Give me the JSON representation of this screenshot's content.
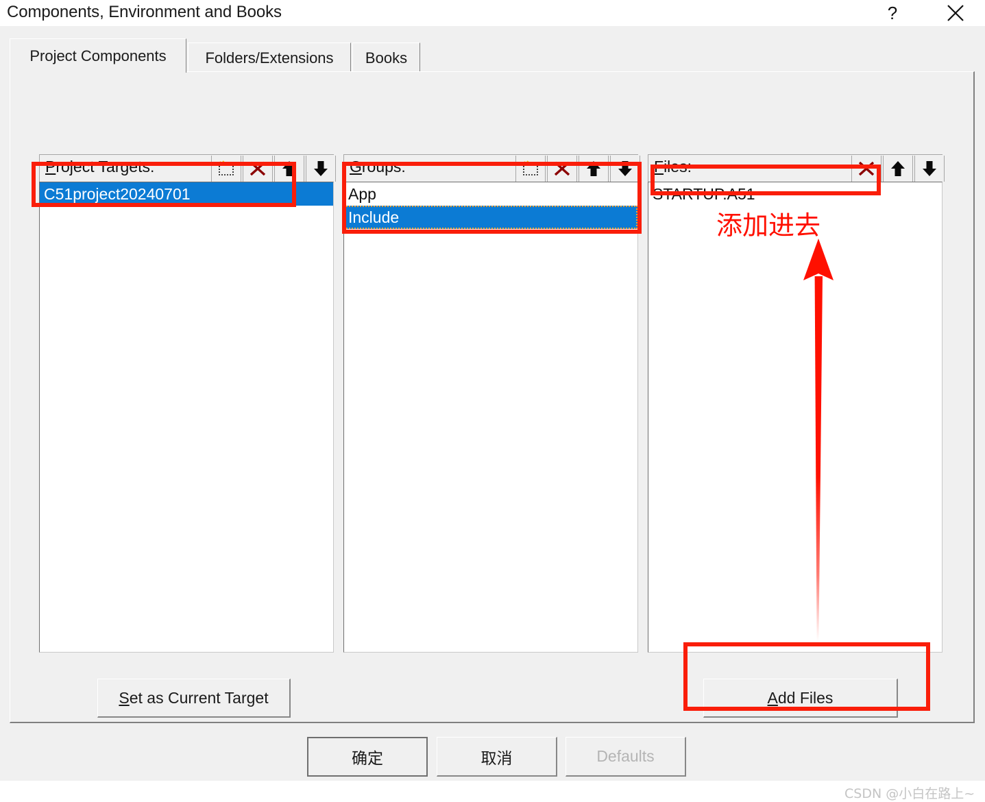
{
  "window": {
    "title": "Components, Environment and Books",
    "help_label": "?",
    "close_label": "close-icon"
  },
  "tabs": [
    {
      "label": "Project Components",
      "selected": true
    },
    {
      "label": "Folders/Extensions",
      "selected": false
    },
    {
      "label": "Books",
      "selected": false
    }
  ],
  "columns": {
    "project_targets": {
      "label_accel": "P",
      "label_rest": "roject Targets:",
      "toolbar": [
        "new-item-icon",
        "delete-icon",
        "move-up-icon",
        "move-down-icon"
      ],
      "items": [
        {
          "text": "C51project20240701",
          "selected": true,
          "focused": false
        }
      ]
    },
    "groups": {
      "label_accel": "G",
      "label_rest": "roups:",
      "toolbar": [
        "new-item-icon",
        "delete-icon",
        "move-up-icon",
        "move-down-icon"
      ],
      "items": [
        {
          "text": "App",
          "selected": false,
          "focused": false
        },
        {
          "text": "Include",
          "selected": true,
          "focused": true
        }
      ]
    },
    "files": {
      "label_accel": "F",
      "label_rest": "iles:",
      "toolbar": [
        "delete-icon",
        "move-up-icon",
        "move-down-icon"
      ],
      "items": [
        {
          "text": "STARTUP.A51",
          "selected": false,
          "focused": false
        }
      ]
    }
  },
  "buttons": {
    "set_as_current_target": {
      "accel": "S",
      "rest": "et as Current Target"
    },
    "add_files": {
      "accel": "A",
      "rest": "dd Files"
    },
    "ok": {
      "label": "确定",
      "default": true
    },
    "cancel": {
      "label": "取消",
      "default": false
    },
    "defaults": {
      "label": "Defaults",
      "disabled": true
    }
  },
  "annotations": {
    "text": "添加进去",
    "arrow": "up-arrow-annotation",
    "highlight_color": "#fa1e0a"
  },
  "watermark": "CSDN @小白在路上~"
}
